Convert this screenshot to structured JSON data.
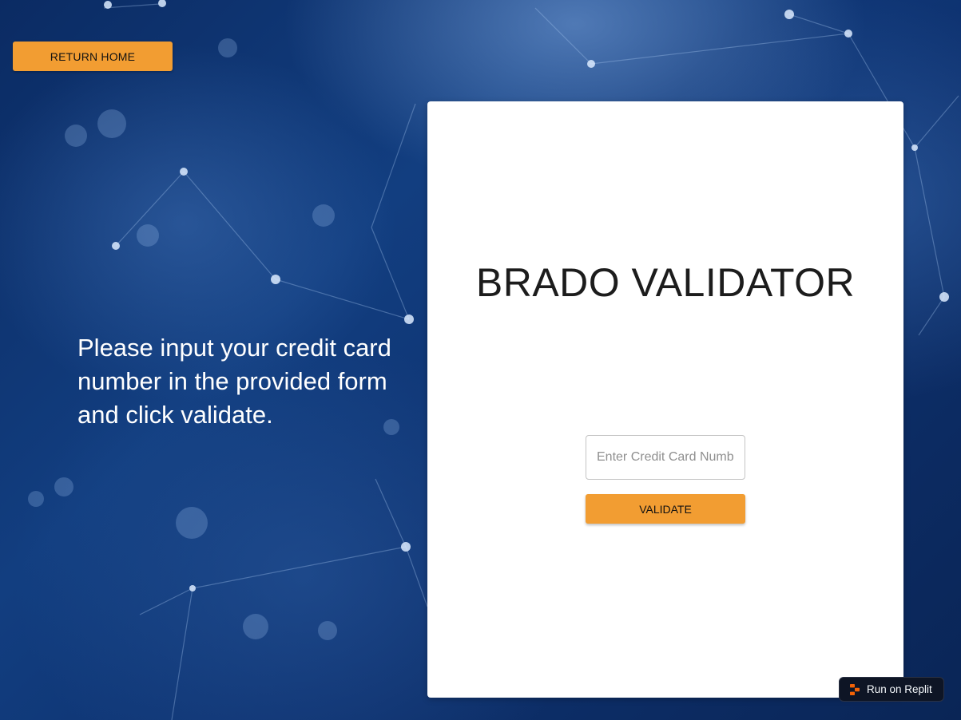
{
  "header": {
    "return_home_label": "RETURN HOME"
  },
  "intro": {
    "instructions": "Please input your credit card number in the provided form and click validate."
  },
  "validator": {
    "title": "BRADO VALIDATOR",
    "card_input_value": "",
    "card_input_placeholder": "Enter Credit Card Number",
    "validate_label": "VALIDATE"
  },
  "badge": {
    "label": "Run on Replit",
    "icon": "replit-logo-icon"
  },
  "colors": {
    "accent": "#f29d32",
    "background": "#123e80",
    "card": "#ffffff",
    "badge": "#0e1525",
    "replit_logo": "#f26207"
  }
}
